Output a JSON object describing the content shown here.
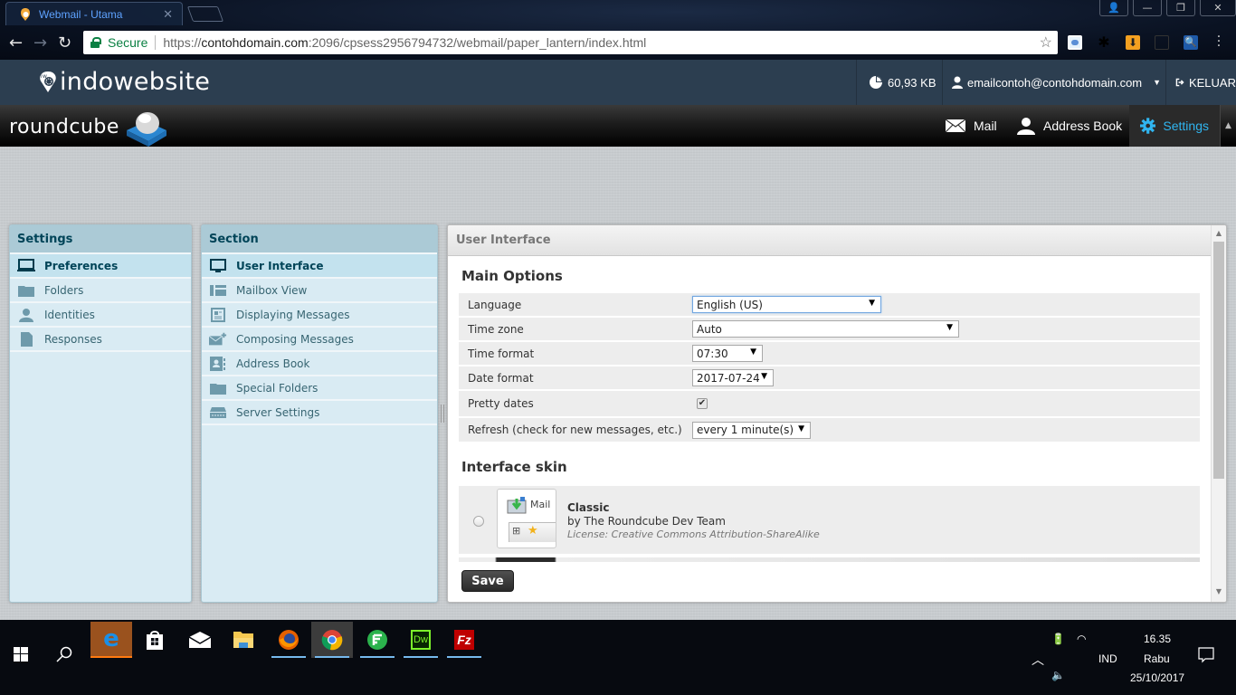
{
  "browser": {
    "tab_title": "Webmail - Utama",
    "secure_label": "Secure",
    "url_scheme": "https://",
    "url_host": "contohdomain.com",
    "url_rest": ":2096/cpsess2956794732/webmail/paper_lantern/index.html",
    "icons": [
      "back-icon",
      "forward-icon",
      "reload-icon",
      "lock-icon",
      "bookmark-star-icon",
      "extension-icon",
      "download-icon",
      "search-extension-icon",
      "menu-icon"
    ]
  },
  "header": {
    "brand": "indowebsite",
    "quota": "60,93 KB",
    "user_email": "emailcontoh@contohdomain.com",
    "logout_label": "KELUAR"
  },
  "roundcube": {
    "logo_text": "roundcube",
    "nav": [
      {
        "label": "Mail",
        "icon": "mail-icon",
        "active": false
      },
      {
        "label": "Address Book",
        "icon": "address-book-icon",
        "active": false
      },
      {
        "label": "Settings",
        "icon": "gear-icon",
        "active": true
      }
    ],
    "accent": "#30b5f0"
  },
  "settings_panel": {
    "title": "Settings",
    "items": [
      {
        "label": "Preferences",
        "icon": "laptop-icon",
        "selected": true
      },
      {
        "label": "Folders",
        "icon": "folder-icon",
        "selected": false
      },
      {
        "label": "Identities",
        "icon": "person-icon",
        "selected": false
      },
      {
        "label": "Responses",
        "icon": "document-icon",
        "selected": false
      }
    ]
  },
  "section_panel": {
    "title": "Section",
    "items": [
      {
        "label": "User Interface",
        "icon": "monitor-icon",
        "selected": true
      },
      {
        "label": "Mailbox View",
        "icon": "list-view-icon",
        "selected": false
      },
      {
        "label": "Displaying Messages",
        "icon": "message-display-icon",
        "selected": false
      },
      {
        "label": "Composing Messages",
        "icon": "compose-icon",
        "selected": false
      },
      {
        "label": "Address Book",
        "icon": "contact-card-icon",
        "selected": false
      },
      {
        "label": "Special Folders",
        "icon": "folder-icon",
        "selected": false
      },
      {
        "label": "Server Settings",
        "icon": "server-icon",
        "selected": false
      }
    ]
  },
  "content": {
    "title": "User Interface",
    "main_options_title": "Main Options",
    "options": [
      {
        "label": "Language",
        "type": "select",
        "value": "English (US)"
      },
      {
        "label": "Time zone",
        "type": "select",
        "value": "Auto"
      },
      {
        "label": "Time format",
        "type": "select",
        "value": "07:30"
      },
      {
        "label": "Date format",
        "type": "select",
        "value": "2017-07-24"
      },
      {
        "label": "Pretty dates",
        "type": "checkbox",
        "checked": true
      },
      {
        "label": "Refresh (check for new messages, etc.)",
        "type": "select",
        "value": "every 1 minute(s)"
      }
    ],
    "skin_title": "Interface skin",
    "skins": [
      {
        "name": "Classic",
        "author": "by The Roundcube Dev Team",
        "license": "License: Creative Commons Attribution-ShareAlike",
        "thumb_label": "Mail",
        "selected": false
      }
    ],
    "save_label": "Save"
  },
  "taskbar": {
    "apps": [
      "edge-icon",
      "store-icon",
      "mail-app-icon",
      "file-explorer-icon",
      "firefox-icon",
      "chrome-icon",
      "feedly-icon",
      "dreamweaver-icon",
      "filezilla-icon"
    ],
    "language": "IND",
    "time": "16.35",
    "day": "Rabu",
    "date": "25/10/2017"
  }
}
